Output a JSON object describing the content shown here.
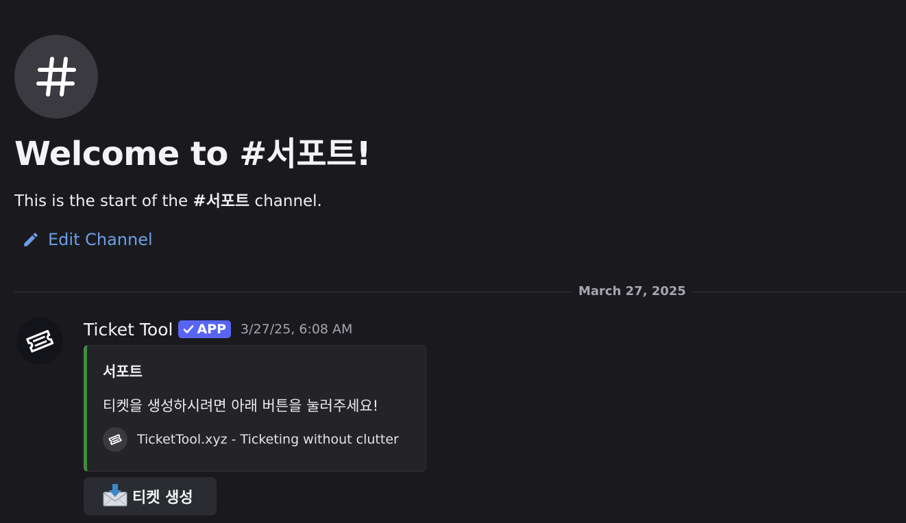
{
  "channel": {
    "icon": "hash-icon",
    "welcome_title": "Welcome to #서포트!",
    "intro_prefix": "This is the start of the ",
    "intro_channel": "#서포트",
    "intro_suffix": " channel.",
    "edit_label": "Edit Channel",
    "edit_icon": "pencil-icon"
  },
  "divider": {
    "date": "March 27, 2025"
  },
  "message": {
    "author": "Ticket Tool",
    "badge": "APP",
    "badge_icon": "checkmark-icon",
    "timestamp": "3/27/25, 6:08 AM",
    "avatar_icon": "ticket-icon",
    "embed": {
      "accent_color": "#3f8f3e",
      "title": "서포트",
      "description": "티켓을 생성하시려면 아래 버튼을 눌러주세요!",
      "footer_icon": "ticket-icon",
      "footer_text": "TicketTool.xyz - Ticketing without clutter"
    },
    "button": {
      "emoji": "📩",
      "label": "티켓 생성"
    }
  },
  "colors": {
    "background": "#1a1a1e",
    "link": "#6b9fe8",
    "badge": "#5865f2"
  }
}
